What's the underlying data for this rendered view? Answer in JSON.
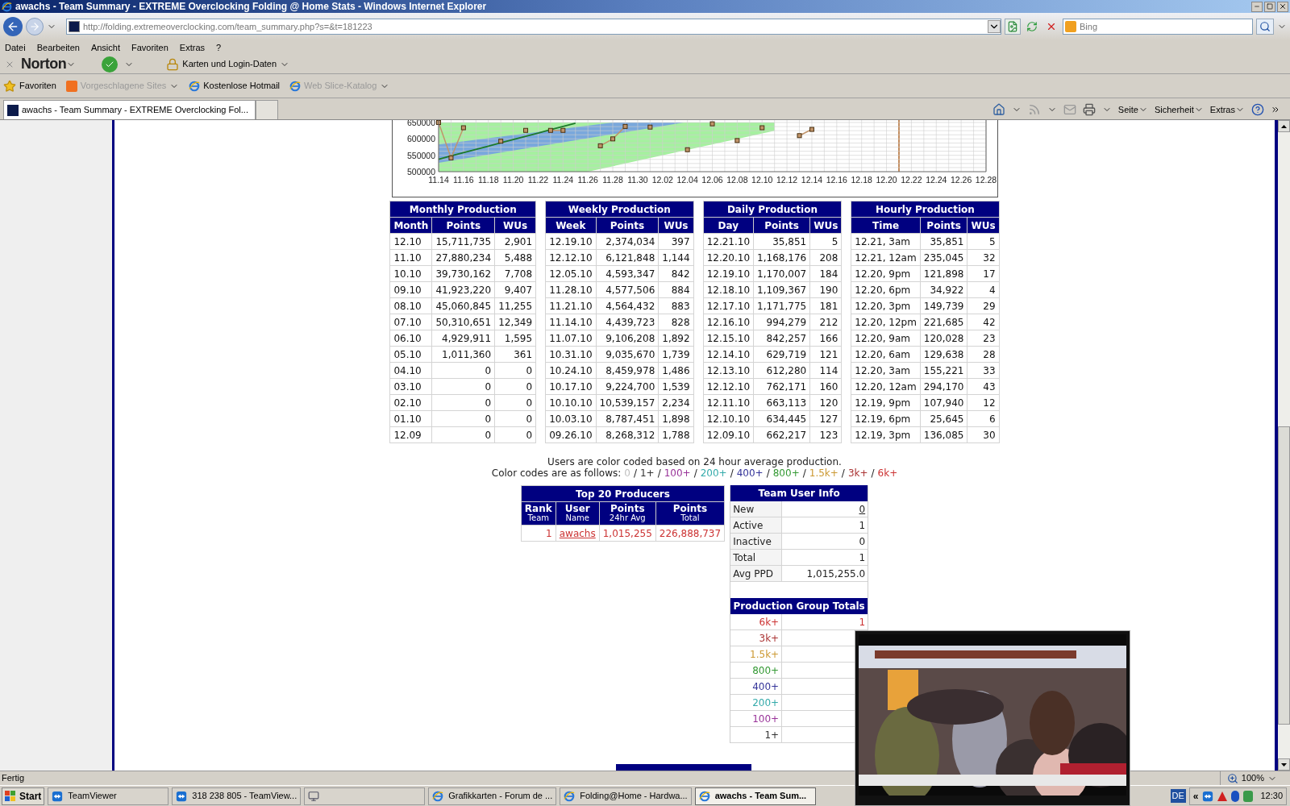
{
  "window": {
    "title": "awachs - Team Summary - EXTREME Overclocking Folding @ Home Stats - Windows Internet Explorer"
  },
  "address_bar": {
    "url": "http://folding.extremeoverclocking.com/team_summary.php?s=&t=181223"
  },
  "search": {
    "placeholder": "Bing"
  },
  "menu": [
    "Datei",
    "Bearbeiten",
    "Ansicht",
    "Favoriten",
    "Extras",
    "?"
  ],
  "norton": {
    "brand": "Norton",
    "identity": "Karten und Login-Daten"
  },
  "favorites_bar": [
    {
      "label": "Favoriten",
      "disabled": false,
      "kind": "star"
    },
    {
      "label": "Vorgeschlagene Sites",
      "disabled": true,
      "kind": "suggest"
    },
    {
      "label": "Kostenlose Hotmail",
      "disabled": false,
      "kind": "ie"
    },
    {
      "label": "Web Slice-Katalog",
      "disabled": true,
      "kind": "ie"
    }
  ],
  "tabs": [
    {
      "label": "awachs - Team Summary - EXTREME Overclocking Fol...",
      "selected": true
    },
    {
      "selected": false
    }
  ],
  "command_bar": [
    "Seite",
    "Sicherheit",
    "Extras"
  ],
  "chart": {
    "chart_data": {
      "type": "line",
      "categories": [
        "11.14",
        null,
        "11.16",
        null,
        "11.18",
        null,
        "11.20",
        null,
        "11.22",
        null,
        "11.24",
        null,
        "11.26",
        null,
        "11.28",
        null,
        "11.30",
        null,
        "12.02",
        null,
        "12.04",
        null,
        "12.06",
        null,
        "12.08",
        null,
        "12.10",
        null,
        "12.12",
        null,
        "12.14",
        null,
        "12.16",
        null,
        "12.18",
        null,
        "12.20",
        null,
        "12.22",
        null,
        "12.24",
        null,
        "12.26",
        null,
        "12.28"
      ],
      "grid": true,
      "series": [
        {
          "color": "#1c7a2a",
          "values": [
            538000,
            548000,
            558000,
            568000,
            578000,
            588000,
            598000,
            608000,
            618000,
            628000,
            638000,
            648000,
            null,
            null,
            null,
            null,
            null,
            null,
            null,
            null,
            null,
            null,
            null,
            null,
            null,
            null,
            null,
            null,
            null,
            null,
            null,
            null,
            null,
            null,
            null,
            null,
            null,
            null,
            null,
            null,
            null,
            null,
            null,
            null,
            null
          ]
        },
        {
          "color": "#c0946a",
          "marker": "square",
          "values": [
            650000,
            542000,
            634000,
            null,
            null,
            593000,
            null,
            626000,
            null,
            626000,
            626000,
            null,
            null,
            579000,
            600000,
            638000,
            null,
            636000,
            null,
            null,
            567000,
            null,
            646000,
            null,
            595000,
            null,
            634000,
            null,
            null,
            610000,
            629000,
            null,
            null,
            null,
            null,
            null,
            null,
            null,
            null,
            null,
            null,
            null,
            null,
            null,
            null
          ]
        }
      ],
      "ylim": [
        500000,
        650000
      ],
      "yticks": [
        500000,
        550000,
        600000,
        650000
      ]
    }
  },
  "production_tables": [
    {
      "title": "Monthly Production",
      "columns": [
        "Month",
        "Points",
        "WUs"
      ],
      "rows": [
        [
          "12.10",
          "15,711,735",
          "2,901"
        ],
        [
          "11.10",
          "27,880,234",
          "5,488"
        ],
        [
          "10.10",
          "39,730,162",
          "7,708"
        ],
        [
          "09.10",
          "41,923,220",
          "9,407"
        ],
        [
          "08.10",
          "45,060,845",
          "11,255"
        ],
        [
          "07.10",
          "50,310,651",
          "12,349"
        ],
        [
          "06.10",
          "4,929,911",
          "1,595"
        ],
        [
          "05.10",
          "1,011,360",
          "361"
        ],
        [
          "04.10",
          "0",
          "0"
        ],
        [
          "03.10",
          "0",
          "0"
        ],
        [
          "02.10",
          "0",
          "0"
        ],
        [
          "01.10",
          "0",
          "0"
        ],
        [
          "12.09",
          "0",
          "0"
        ]
      ]
    },
    {
      "title": "Weekly Production",
      "columns": [
        "Week",
        "Points",
        "WUs"
      ],
      "rows": [
        [
          "12.19.10",
          "2,374,034",
          "397"
        ],
        [
          "12.12.10",
          "6,121,848",
          "1,144"
        ],
        [
          "12.05.10",
          "4,593,347",
          "842"
        ],
        [
          "11.28.10",
          "4,577,506",
          "884"
        ],
        [
          "11.21.10",
          "4,564,432",
          "883"
        ],
        [
          "11.14.10",
          "4,439,723",
          "828"
        ],
        [
          "11.07.10",
          "9,106,208",
          "1,892"
        ],
        [
          "10.31.10",
          "9,035,670",
          "1,739"
        ],
        [
          "10.24.10",
          "8,459,978",
          "1,486"
        ],
        [
          "10.17.10",
          "9,224,700",
          "1,539"
        ],
        [
          "10.10.10",
          "10,539,157",
          "2,234"
        ],
        [
          "10.03.10",
          "8,787,451",
          "1,898"
        ],
        [
          "09.26.10",
          "8,268,312",
          "1,788"
        ]
      ]
    },
    {
      "title": "Daily Production",
      "columns": [
        "Day",
        "Points",
        "WUs"
      ],
      "rows": [
        [
          "12.21.10",
          "35,851",
          "5"
        ],
        [
          "12.20.10",
          "1,168,176",
          "208"
        ],
        [
          "12.19.10",
          "1,170,007",
          "184"
        ],
        [
          "12.18.10",
          "1,109,367",
          "190"
        ],
        [
          "12.17.10",
          "1,171,775",
          "181"
        ],
        [
          "12.16.10",
          "994,279",
          "212"
        ],
        [
          "12.15.10",
          "842,257",
          "166"
        ],
        [
          "12.14.10",
          "629,719",
          "121"
        ],
        [
          "12.13.10",
          "612,280",
          "114"
        ],
        [
          "12.12.10",
          "762,171",
          "160"
        ],
        [
          "12.11.10",
          "663,113",
          "120"
        ],
        [
          "12.10.10",
          "634,445",
          "127"
        ],
        [
          "12.09.10",
          "662,217",
          "123"
        ]
      ]
    },
    {
      "title": "Hourly Production",
      "columns": [
        "Time",
        "Points",
        "WUs"
      ],
      "rows": [
        [
          "12.21, 3am",
          "35,851",
          "5"
        ],
        [
          "12.21, 12am",
          "235,045",
          "32"
        ],
        [
          "12.20, 9pm",
          "121,898",
          "17"
        ],
        [
          "12.20, 6pm",
          "34,922",
          "4"
        ],
        [
          "12.20, 3pm",
          "149,739",
          "29"
        ],
        [
          "12.20, 12pm",
          "221,685",
          "42"
        ],
        [
          "12.20, 9am",
          "120,028",
          "23"
        ],
        [
          "12.20, 6am",
          "129,638",
          "28"
        ],
        [
          "12.20, 3am",
          "155,221",
          "33"
        ],
        [
          "12.20, 12am",
          "294,170",
          "43"
        ],
        [
          "12.19, 9pm",
          "107,940",
          "12"
        ],
        [
          "12.19, 6pm",
          "25,645",
          "6"
        ],
        [
          "12.19, 3pm",
          "136,085",
          "30"
        ]
      ]
    }
  ],
  "color_note": {
    "line": "Users are color coded based on 24 hour average production.",
    "prefix": "Color codes are as follows:",
    "separator": "/",
    "codes": [
      {
        "label": "0",
        "color": "#c0c0c0"
      },
      {
        "label": "1+",
        "color": "#333333"
      },
      {
        "label": "100+",
        "color": "#993399"
      },
      {
        "label": "200+",
        "color": "#33aaaa"
      },
      {
        "label": "400+",
        "color": "#333399"
      },
      {
        "label": "800+",
        "color": "#339933"
      },
      {
        "label": "1.5k+",
        "color": "#cc9933"
      },
      {
        "label": "3k+",
        "color": "#aa3333"
      },
      {
        "label": "6k+",
        "color": "#cc3333"
      }
    ]
  },
  "top_producers": {
    "title": "Top 20 Producers",
    "columns": [
      {
        "label": "Rank",
        "sub": "Team"
      },
      {
        "label": "User",
        "sub": "Name"
      },
      {
        "label": "Points",
        "sub": "24hr Avg"
      },
      {
        "label": "Points",
        "sub": "Total"
      }
    ],
    "rows": [
      {
        "rank": "1",
        "user": "awachs",
        "avg": "1,015,255",
        "total": "226,888,737",
        "color": "#cc3333"
      }
    ]
  },
  "team_user_info": {
    "title": "Team User Info",
    "rows": [
      {
        "label": "New",
        "value": "0",
        "link": true
      },
      {
        "label": "Active",
        "value": "1",
        "link": false
      },
      {
        "label": "Inactive",
        "value": "0",
        "link": false
      },
      {
        "label": "Total",
        "value": "1",
        "link": false
      },
      {
        "label": "Avg PPD",
        "value": "1,015,255.0",
        "link": false
      }
    ]
  },
  "production_group_totals": {
    "title": "Production Group Totals",
    "rows": [
      {
        "label": "6k+",
        "color": "#cc3333",
        "value": "1"
      },
      {
        "label": "3k+",
        "color": "#aa3333"
      },
      {
        "label": "1.5k+",
        "color": "#cc9933"
      },
      {
        "label": "800+",
        "color": "#339933"
      },
      {
        "label": "400+",
        "color": "#333399"
      },
      {
        "label": "200+",
        "color": "#33aaaa"
      },
      {
        "label": "100+",
        "color": "#993399"
      },
      {
        "label": "1+",
        "color": "#333333"
      }
    ]
  },
  "video_overlay": {
    "kind": "picture"
  },
  "status_bar": {
    "text": "Fertig",
    "zoom": "100%"
  },
  "taskbar": {
    "start": "Start",
    "items": [
      {
        "label": "TeamViewer",
        "kind": "teamviewer",
        "selected": false
      },
      {
        "label": "318 238 805 - TeamView...",
        "kind": "teamviewer",
        "selected": false
      },
      {
        "kind": "screen",
        "selected": false
      },
      {
        "label": "Grafikkarten - Forum de ...",
        "kind": "ie",
        "selected": false
      },
      {
        "label": "Folding@Home - Hardwa...",
        "kind": "ie",
        "selected": false
      },
      {
        "label": "awachs - Team Sum...",
        "kind": "ie",
        "selected": true
      }
    ],
    "language": "DE",
    "tray_expand": "«",
    "clock": "12:30"
  }
}
